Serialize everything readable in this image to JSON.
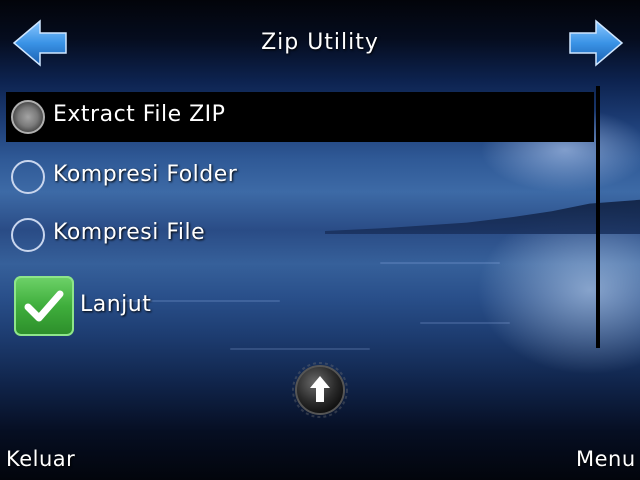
{
  "header": {
    "title": "Zip Utility",
    "back_icon": "left-arrow-icon",
    "forward_icon": "right-arrow-icon"
  },
  "options": [
    {
      "label": "Extract File ZIP",
      "selected": true
    },
    {
      "label": "Kompresi Folder",
      "selected": false
    },
    {
      "label": "Kompresi File",
      "selected": false
    }
  ],
  "checkbox": {
    "label": "Lanjut",
    "checked": true
  },
  "scroll_up_icon": "up-arrow-icon",
  "softkeys": {
    "left": "Keluar",
    "right": "Menu"
  },
  "colors": {
    "arrow_blue": "#3a93e6",
    "check_green": "#3fae3c",
    "selection_bg": "#000000"
  }
}
